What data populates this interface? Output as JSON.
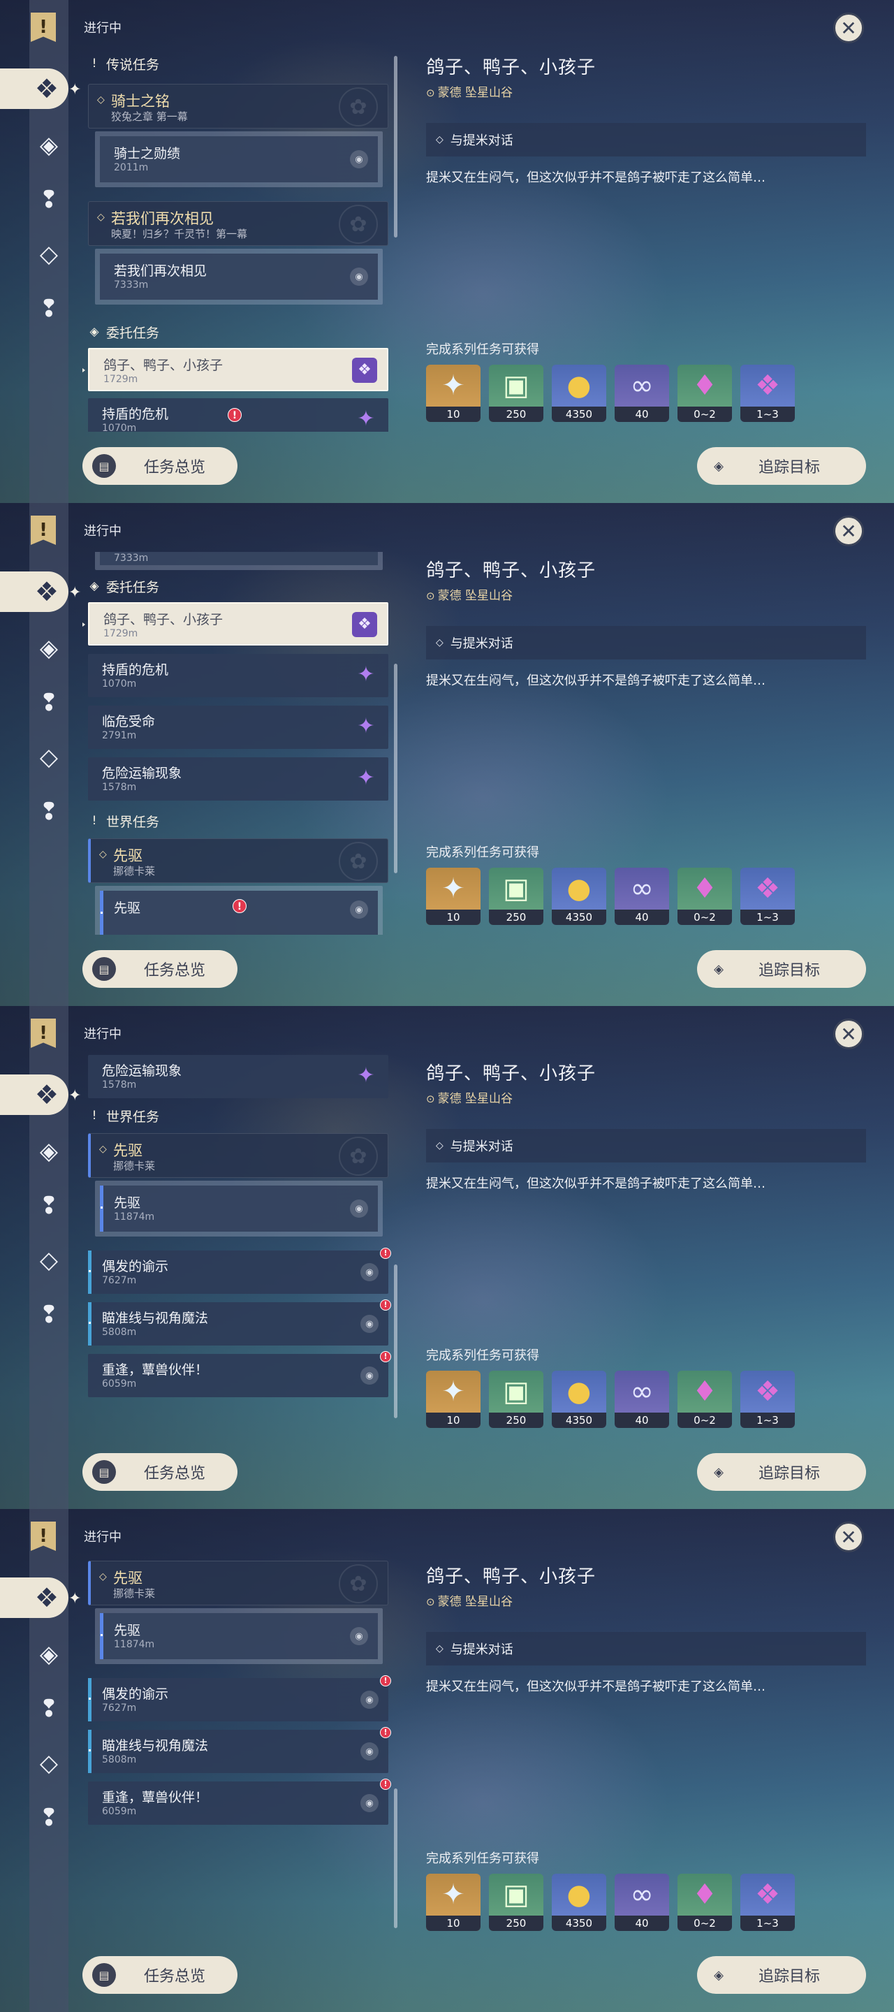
{
  "header": {
    "title": "进行中",
    "close_icon": "close-icon"
  },
  "sidebar": {
    "bookmark_icon": "bookmark-icon",
    "tabs": [
      "all-quests-icon",
      "archon-quest-icon",
      "story-quest-icon",
      "commission-icon",
      "world-quest-icon"
    ]
  },
  "list": {
    "legend_header": "传说任务",
    "commission_header": "委托任务",
    "world_header": "世界任务",
    "legend_group1": {
      "title": "骑士之铭",
      "subtitle": "狡兔之章 第一幕"
    },
    "legend_sub1": {
      "title": "骑士之勋绩",
      "distance": "2011m"
    },
    "legend_group2": {
      "title": "若我们再次相见",
      "subtitle": "映夏！归乡？千灵节！第一幕"
    },
    "legend_sub2": {
      "title": "若我们再次相见",
      "distance": "7333m"
    },
    "legend_sub2_partial": "7333m",
    "commissions": [
      {
        "title": "鸽子、鸭子、小孩子",
        "distance": "1729m"
      },
      {
        "title": "持盾的危机",
        "distance": "1070m"
      },
      {
        "title": "临危受命",
        "distance": "2791m"
      },
      {
        "title": "危险运输现象",
        "distance": "1578m"
      }
    ],
    "world_group": {
      "title": "先驱",
      "subtitle": "挪德卡莱"
    },
    "world_sub": {
      "title": "先驱",
      "distance": "11874m"
    },
    "world_items": [
      {
        "title": "偶发的谕示",
        "distance": "7627m"
      },
      {
        "title": "瞄准线与视角魔法",
        "distance": "5808m"
      },
      {
        "title": "重逢，蕈兽伙伴！",
        "distance": "6059m"
      }
    ]
  },
  "detail": {
    "title": "鸽子、鸭子、小孩子",
    "location": "蒙德 坠星山谷",
    "objective": "与提米对话",
    "description": "提米又在生闷气，但这次似乎并不是鸽子被吓走了这么简单…",
    "rewards_label": "完成系列任务可获得",
    "rewards": [
      {
        "icon": "primogem-icon",
        "amount": "10",
        "color": "orange"
      },
      {
        "icon": "adventure-exp-icon",
        "amount": "250",
        "color": "green"
      },
      {
        "icon": "mora-icon",
        "amount": "4350",
        "color": "blue"
      },
      {
        "icon": "companionship-exp-icon",
        "amount": "40",
        "color": "purple"
      },
      {
        "icon": "crystal-chunk-icon",
        "amount": "0~2",
        "color": "green"
      },
      {
        "icon": "crystal-cluster-icon",
        "amount": "1~3",
        "color": "blue"
      }
    ]
  },
  "footer": {
    "overview_label": "任务总览",
    "track_label": "追踪目标"
  },
  "colors": {
    "accent_cream": "#ece6d8",
    "gold": "#f2dfae",
    "alert_red": "#e2384e",
    "commission_purple": "#b07ef0"
  }
}
